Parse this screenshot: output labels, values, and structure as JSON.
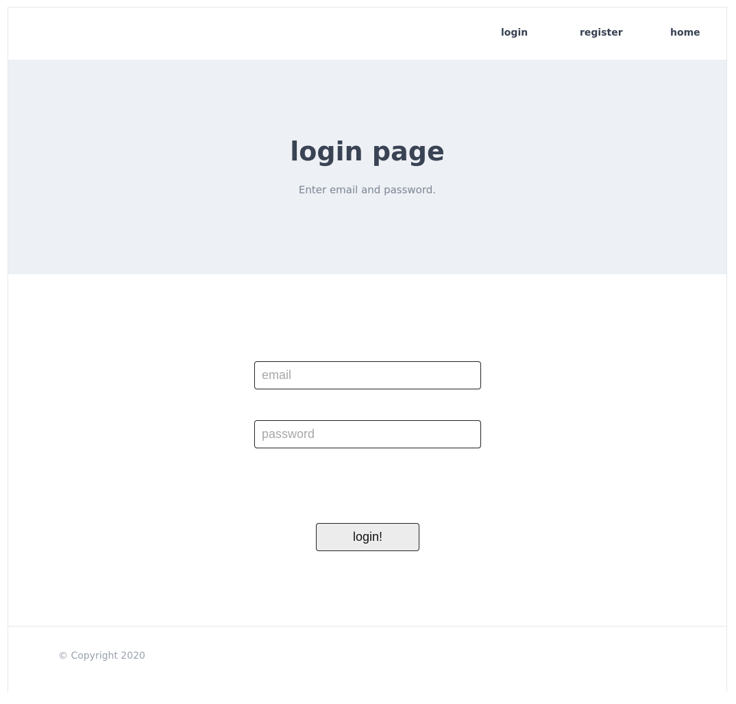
{
  "nav": {
    "login_label": "login",
    "register_label": "register",
    "home_label": "home"
  },
  "hero": {
    "title": "login page",
    "subtitle": "Enter email and password."
  },
  "form": {
    "email": {
      "placeholder": "email",
      "value": ""
    },
    "password": {
      "placeholder": "password",
      "value": ""
    },
    "submit_label": "login!"
  },
  "footer": {
    "copyright": "© Copyright 2020"
  },
  "colors": {
    "hero_background": "#edf0f4",
    "heading_text": "#3a4354",
    "nav_text": "#374151",
    "muted_text": "#7d8696",
    "button_background": "#ececec"
  }
}
